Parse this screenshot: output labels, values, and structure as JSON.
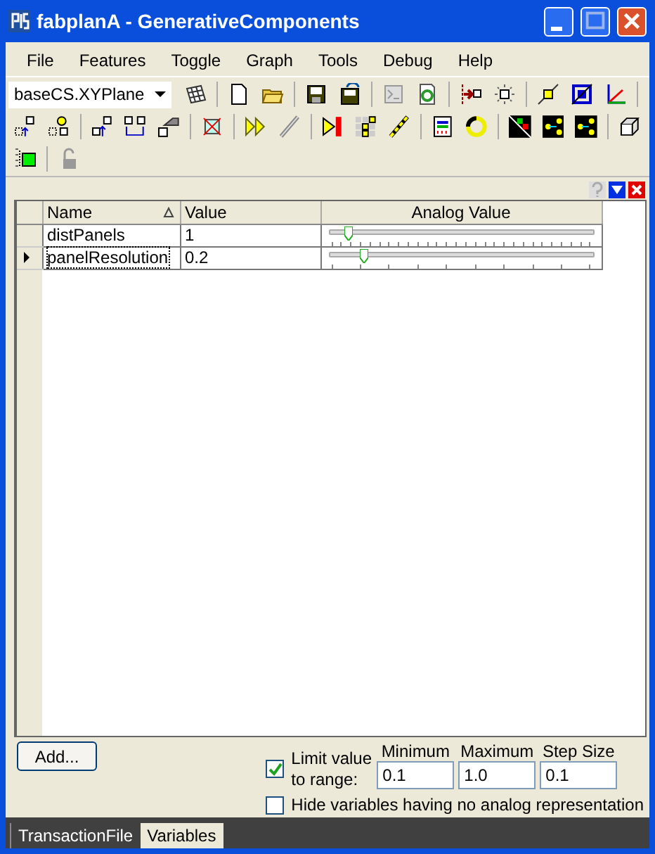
{
  "window": {
    "title": "fabplanA - GenerativeComponents"
  },
  "menu": [
    "File",
    "Features",
    "Toggle",
    "Graph",
    "Tools",
    "Debug",
    "Help"
  ],
  "toolbar": {
    "combo": {
      "value": "baseCS.XYPlane"
    }
  },
  "grid": {
    "columns": [
      "Name",
      "Value",
      "Analog Value"
    ],
    "rows": [
      {
        "name": "distPanels",
        "value": "1",
        "level": 0.06,
        "selected": false
      },
      {
        "name": "panelResolution",
        "value": "0.2",
        "level": 0.12,
        "selected": true
      }
    ]
  },
  "add_button": "Add...",
  "limit": {
    "label": "Limit value to range:",
    "checked": true
  },
  "minimum": {
    "label": "Minimum",
    "value": "0.1"
  },
  "maximum": {
    "label": "Maximum",
    "value": "1.0"
  },
  "step": {
    "label": "Step Size",
    "value": "0.1"
  },
  "hide": {
    "label": "Hide variables having no analog representation",
    "checked": false
  },
  "tabs": [
    {
      "label": "TransactionFile",
      "selected": false
    },
    {
      "label": "Variables",
      "selected": true
    }
  ]
}
